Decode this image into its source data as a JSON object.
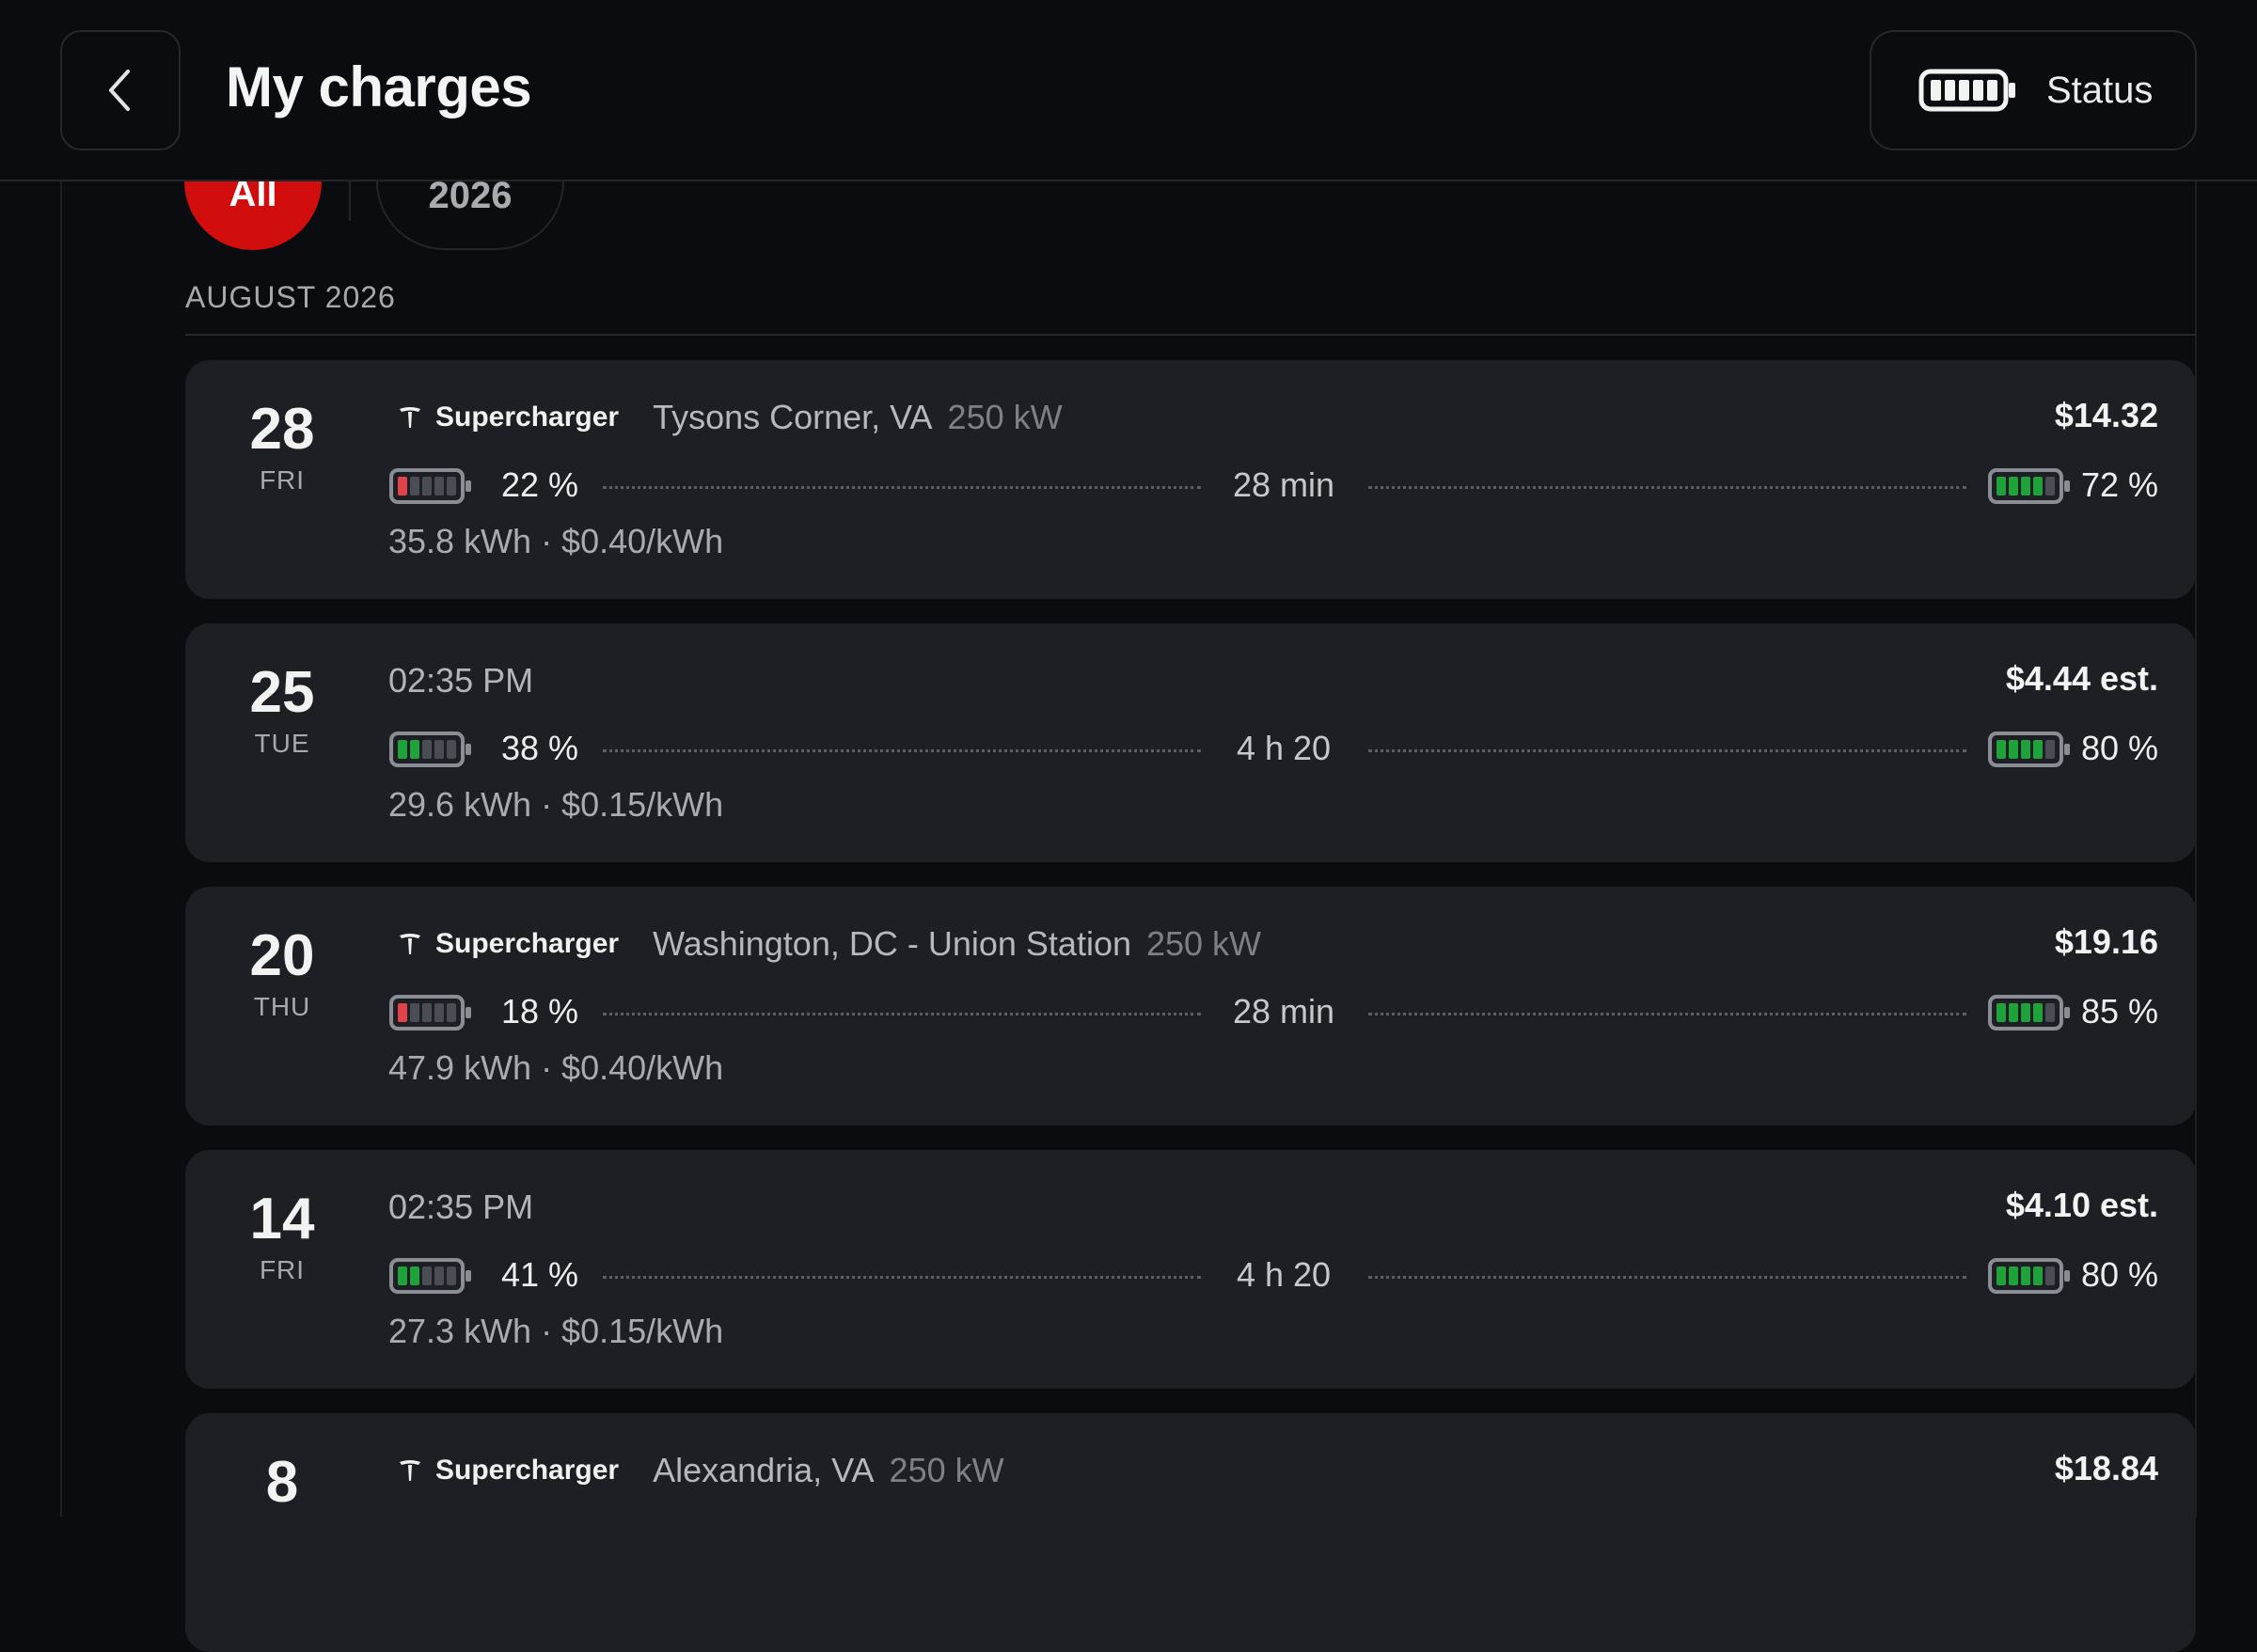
{
  "header": {
    "title": "My charges",
    "status_label": "Status"
  },
  "filters": {
    "all_label": "All",
    "year_label": "2026"
  },
  "month_label": "AUGUST 2026",
  "colors": {
    "accent_red": "#d10d0d",
    "battery_low": "#e2434b",
    "battery_good": "#1fa23a"
  },
  "charges": [
    {
      "day": "28",
      "weekday": "FRI",
      "type": "supercharger",
      "station_label": "Supercharger",
      "location": "Tysons Corner, VA",
      "power": "250 kW",
      "price": "$14.32",
      "start_pct": "22 %",
      "start_level": 0.22,
      "start_color": "#e2434b",
      "duration": "28 min",
      "end_pct": "72 %",
      "end_level": 0.72,
      "end_color": "#1fa23a",
      "energy": "35.8 kWh · $0.40/kWh"
    },
    {
      "day": "25",
      "weekday": "TUE",
      "type": "home",
      "time": "02:35 PM",
      "price": "$4.44 est.",
      "start_pct": "38 %",
      "start_level": 0.38,
      "start_color": "#1fa23a",
      "duration": "4 h 20",
      "end_pct": "80 %",
      "end_level": 0.8,
      "end_color": "#1fa23a",
      "energy": "29.6 kWh · $0.15/kWh"
    },
    {
      "day": "20",
      "weekday": "THU",
      "type": "supercharger",
      "station_label": "Supercharger",
      "location": "Washington, DC - Union Station",
      "power": "250 kW",
      "price": "$19.16",
      "start_pct": "18 %",
      "start_level": 0.18,
      "start_color": "#e2434b",
      "duration": "28 min",
      "end_pct": "85 %",
      "end_level": 0.85,
      "end_color": "#1fa23a",
      "energy": "47.9 kWh · $0.40/kWh"
    },
    {
      "day": "14",
      "weekday": "FRI",
      "type": "home",
      "time": "02:35 PM",
      "price": "$4.10 est.",
      "start_pct": "41 %",
      "start_level": 0.41,
      "start_color": "#1fa23a",
      "duration": "4 h 20",
      "end_pct": "80 %",
      "end_level": 0.8,
      "end_color": "#1fa23a",
      "energy": "27.3 kWh · $0.15/kWh"
    },
    {
      "day": "8",
      "weekday": "",
      "type": "supercharger",
      "station_label": "Supercharger",
      "location": "Alexandria, VA",
      "power": "250 kW",
      "price": "$18.84"
    }
  ]
}
